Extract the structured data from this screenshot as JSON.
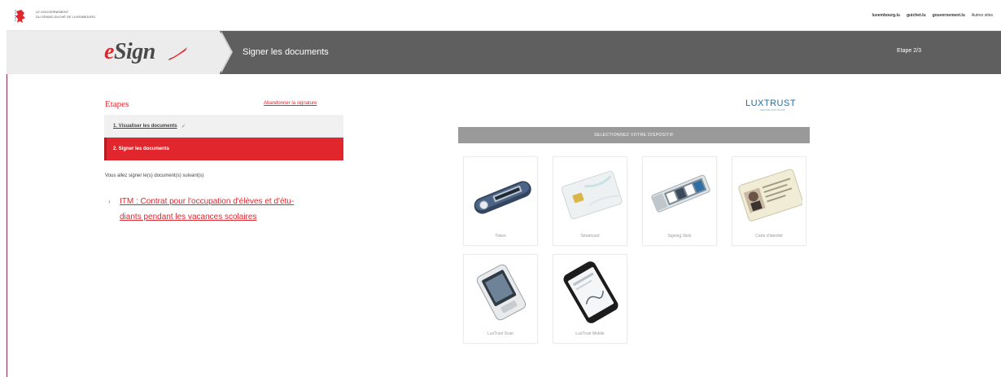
{
  "gov": {
    "line1": "LE GOUVERNEMENT",
    "line2": "DU GRAND-DUCHÉ DE LUXEMBOURG",
    "links": [
      "luxembourg.lu",
      "guichet.lu",
      "gouvernement.lu",
      "Autres sites"
    ]
  },
  "header": {
    "logo_e": "e",
    "logo_sign": "Sign",
    "title": "Signer les documents",
    "step": "Etape 2/3"
  },
  "steps": {
    "title": "Etapes",
    "abandon": "Abandonner la signature",
    "items": [
      {
        "label": "1. Visualiser les documents",
        "status": "done"
      },
      {
        "label": "2. Signer les documents",
        "status": "active"
      }
    ]
  },
  "info": "Vous allez signer le(s) document(s) suivant(s)",
  "documents": [
    {
      "line1": "ITM : Contrat pour l'occupation d'élèves et d'étu-",
      "line2": "diants pendant les vacances scolaires"
    }
  ],
  "luxtrust": {
    "name": "LUXTRUST",
    "tagline": "SECURE SOLUTIONS"
  },
  "device_bar": "SELECTIONNEZ VOTRE DISPOSITIF",
  "devices": [
    {
      "label": "Token"
    },
    {
      "label": "Smartcard"
    },
    {
      "label": "Signing Stick"
    },
    {
      "label": "Carte d'identité"
    },
    {
      "label": "LuxTrust Scan"
    },
    {
      "label": "LuxTrust Mobile"
    }
  ],
  "colors": {
    "accent": "#e1262d",
    "header": "#5f5f5f",
    "luxtrust": "#1f6fa3"
  }
}
